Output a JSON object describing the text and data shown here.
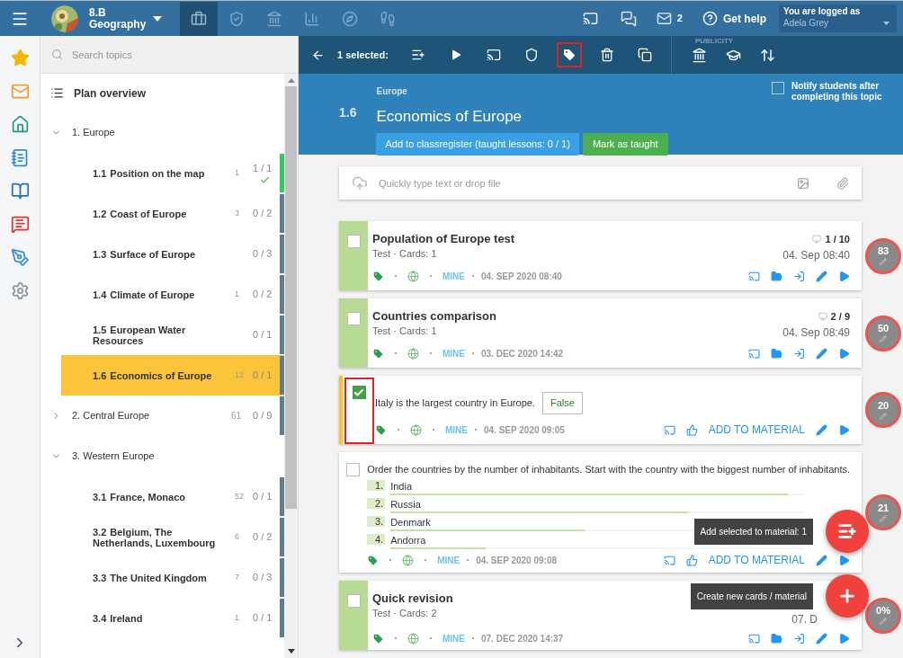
{
  "topbar": {
    "class_name": "8.B",
    "subject": "Geography",
    "nav": [
      {
        "kind": "briefcase",
        "selected": true
      },
      {
        "kind": "shield",
        "selected": false
      },
      {
        "kind": "bank",
        "selected": false
      },
      {
        "kind": "chart",
        "selected": false
      },
      {
        "kind": "compass",
        "selected": false
      },
      {
        "kind": "hikers",
        "selected": false
      }
    ],
    "messages_count": "2",
    "help": "Get help",
    "user_caption": "You are logged as",
    "user_name": "Adela Grey"
  },
  "rail": [
    {
      "kind": "star"
    },
    {
      "kind": "mail"
    },
    {
      "kind": "home"
    },
    {
      "kind": "notebook"
    },
    {
      "kind": "book"
    },
    {
      "kind": "chat"
    },
    {
      "kind": "pen"
    },
    {
      "kind": "gear"
    }
  ],
  "topics": {
    "search_placeholder": "Search topics",
    "plan_overview": "Plan overview",
    "groups": [
      {
        "title": "1. Europe",
        "expanded": true,
        "children": [
          {
            "number": "1.1",
            "title": "Position on the map",
            "count": "1",
            "progress": "1 / 1",
            "done": true,
            "selected": false
          },
          {
            "number": "1.2",
            "title": "Coast of Europe",
            "count": "3",
            "progress": "0 / 2",
            "done": false,
            "selected": false
          },
          {
            "number": "1.3",
            "title": "Surface of Europe",
            "progress": "0 / 3",
            "done": false,
            "selected": false
          },
          {
            "number": "1.4",
            "title": "Climate of Europe",
            "count": "1",
            "progress": "0 / 2",
            "done": false,
            "selected": false
          },
          {
            "number": "1.5",
            "title": "European Water Resources",
            "progress": "0 / 1",
            "done": false,
            "selected": false
          },
          {
            "number": "1.6",
            "title": "Economics of Europe",
            "count": "12",
            "progress": "0 / 1",
            "done": false,
            "selected": true
          }
        ]
      },
      {
        "title": "2. Central Europe",
        "expanded": false,
        "count": "61",
        "progress": "0 / 9"
      },
      {
        "title": "3. Western Europe",
        "expanded": true,
        "children": [
          {
            "number": "3.1",
            "title": "France, Monaco",
            "count": "52",
            "progress": "0 / 1",
            "done": false,
            "selected": false
          },
          {
            "number": "3.2",
            "title": "Belgium, The Netherlands, Luxembourg",
            "count": "6",
            "progress": "0 / 2",
            "done": false,
            "selected": false
          },
          {
            "number": "3.3",
            "title": "The United Kingdom",
            "count": "7",
            "progress": "0 / 3",
            "done": false,
            "selected": false
          },
          {
            "number": "3.4",
            "title": "Ireland",
            "count": "1",
            "progress": "0 / 1",
            "done": false,
            "selected": false
          }
        ]
      }
    ]
  },
  "toolbar": {
    "selected_label": "1 selected:",
    "actions": [
      {
        "kind": "add-list",
        "highlighted": false
      },
      {
        "kind": "play",
        "highlighted": false
      },
      {
        "kind": "cast",
        "highlighted": false
      },
      {
        "kind": "shield",
        "highlighted": false
      },
      {
        "kind": "tag",
        "highlighted": true
      },
      {
        "kind": "trash",
        "highlighted": false
      },
      {
        "kind": "copy",
        "highlighted": false
      }
    ],
    "publicity_label": "PUBLICITY",
    "publicity_actions": [
      {
        "kind": "bank"
      },
      {
        "kind": "cap"
      },
      {
        "kind": "sort"
      }
    ]
  },
  "header": {
    "parent": "Europe",
    "number": "1.6",
    "title": "Economics of Europe",
    "register_button": "Add to classregister (taught lessons: 0 / 1)",
    "taught_button": "Mark as taught",
    "notify_label": "Notify students after completing this topic",
    "notify_checked": false
  },
  "composer": {
    "placeholder": "Quickly type text or drop file"
  },
  "cards": [
    {
      "kind": "material",
      "checked": false,
      "title": "Population of Europe test",
      "subtitle": "Test · Cards: 1",
      "score": "1 / 10",
      "date": "04. Sep 08:40",
      "owner": "MINE",
      "created": "04. SEP 2020 08:40",
      "ring": "83"
    },
    {
      "kind": "material",
      "checked": false,
      "title": "Countries comparison",
      "subtitle": "Test · Cards: 1",
      "score": "2 / 9",
      "date": "04. Sep 08:49",
      "owner": "MINE",
      "created": "03. DEC 2020 14:42",
      "ring": "50"
    },
    {
      "kind": "truefalse",
      "checked": true,
      "highlighted": true,
      "question": "Italy is the largest country in Europe.",
      "answer": "False",
      "owner": "MINE",
      "created": "04. SEP 2020 09:05",
      "add_label": "ADD TO MATERIAL",
      "ring": "20"
    },
    {
      "kind": "order",
      "checked": false,
      "question": "Order the countries by the number of inhabitants. Start with the country with the biggest number of inhabitants.",
      "items": [
        {
          "n": "1.",
          "text": "India",
          "level": 0.96
        },
        {
          "n": "2.",
          "text": "Russia",
          "level": 0.72
        },
        {
          "n": "3.",
          "text": "Denmark",
          "level": 0.47
        },
        {
          "n": "4.",
          "text": "Andorra",
          "level": 0.23
        }
      ],
      "owner": "MINE",
      "created": "04. SEP 2020 09:08",
      "add_label": "ADD TO MATERIAL",
      "ring": "21"
    },
    {
      "kind": "material",
      "checked": false,
      "title": "Quick revision",
      "subtitle": "Test · Cards: 2",
      "date": "07. D",
      "owner": "MINE",
      "created": "07. DEC 2020 14:37",
      "ring": "0%"
    }
  ],
  "fabs": [
    {
      "kind": "add-selected",
      "tooltip": "Add selected to material: 1"
    },
    {
      "kind": "create",
      "tooltip": "Create new cards / material"
    }
  ]
}
